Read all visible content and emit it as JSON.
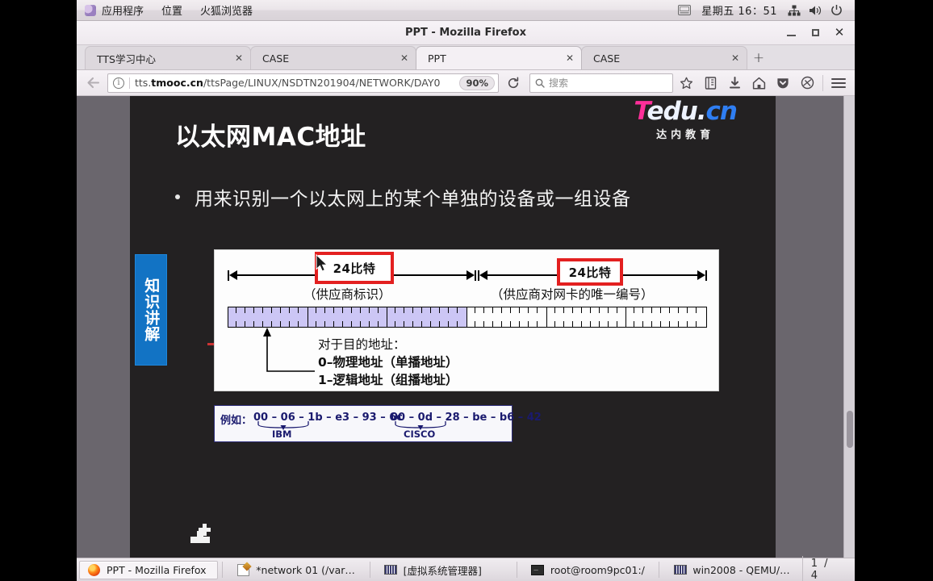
{
  "desktop": {
    "panel": {
      "menus": [
        "应用程序",
        "位置",
        "火狐浏览器"
      ],
      "clock": "星期五 16：51",
      "tray_icons": [
        "keyboard-icon",
        "network-icon",
        "volume-icon",
        "power-icon"
      ]
    },
    "taskbar": {
      "items": [
        {
          "label": "PPT - Mozilla Firefox",
          "icon": "firefox-icon",
          "active": true
        },
        {
          "label": "*network 01 (/var/ftp/···",
          "icon": "gedit-icon",
          "active": false
        },
        {
          "label": "[虚拟系统管理器]",
          "icon": "virt-manager-icon",
          "active": false
        },
        {
          "label": "root@room9pc01:/",
          "icon": "terminal-icon",
          "active": false
        },
        {
          "label": "win2008 - QEMU/KVM",
          "icon": "qemu-icon",
          "active": false
        }
      ],
      "workspace_pager": "1 / 4"
    }
  },
  "browser": {
    "window_title": "PPT - Mozilla Firefox",
    "window_buttons": [
      "minimize-button",
      "maximize-button",
      "close-button"
    ],
    "tabs": [
      {
        "label": "TTS学习中心",
        "active": false
      },
      {
        "label": "CASE",
        "active": false
      },
      {
        "label": "PPT",
        "active": true
      },
      {
        "label": "CASE",
        "active": false
      }
    ],
    "new_tab_label": "+",
    "navigation": {
      "back_label": "←",
      "url_host": "tts.tmooc.cn",
      "url_host_bold": "tmooc.cn",
      "url_host_prefix": "tts.",
      "url_path": "/ttsPage/LINUX/NSDTN201904/NETWORK/DAY0",
      "zoom_level": "90%",
      "reload_label": "⟳",
      "search_placeholder": "搜索",
      "toolbar_icons": [
        "bookmark-star-icon",
        "library-icon",
        "downloads-icon",
        "home-icon",
        "pocket-icon",
        "sync-icon",
        "menu-icon"
      ]
    }
  },
  "slide": {
    "title": "以太网MAC地址",
    "logo": {
      "t": "T",
      "edu": "edu.",
      "cn": "cn",
      "subtitle": "达内教育"
    },
    "bullet": "用来识别一个以太网上的某个单独的设备或一组设备",
    "side_tab": "知识讲解",
    "diagram": {
      "left_badge": "24比特",
      "left_caption": "（供应商标识）",
      "right_badge": "24比特",
      "right_caption": "（供应商对网卡的唯一编号）",
      "note_lines": [
        "对于目的地址：",
        "0–物理地址（单播地址）",
        "1–逻辑地址（组播地址）"
      ],
      "bit_segments": [
        {
          "filled": true
        },
        {
          "filled": true
        },
        {
          "filled": true
        },
        {
          "filled": false
        },
        {
          "filled": false
        },
        {
          "filled": false
        }
      ]
    },
    "example": {
      "label": "例如：",
      "mac_ibm": "00 – 06 – 1b – e3 – 93 – 6c",
      "vendor_ibm": "IBM",
      "mac_cisco": "00 – 0d – 28 – be – b6 – 42",
      "vendor_cisco": "CISCO"
    }
  },
  "colors": {
    "slide_background": "#232122",
    "accent_blue": "#1273c4",
    "highlight_red": "#e32020",
    "bit_fill": "#ccc6f5",
    "example_navy": "#1a1a6e",
    "logo_pink": "#ff2f9a",
    "logo_blue": "#2f7ef2"
  }
}
